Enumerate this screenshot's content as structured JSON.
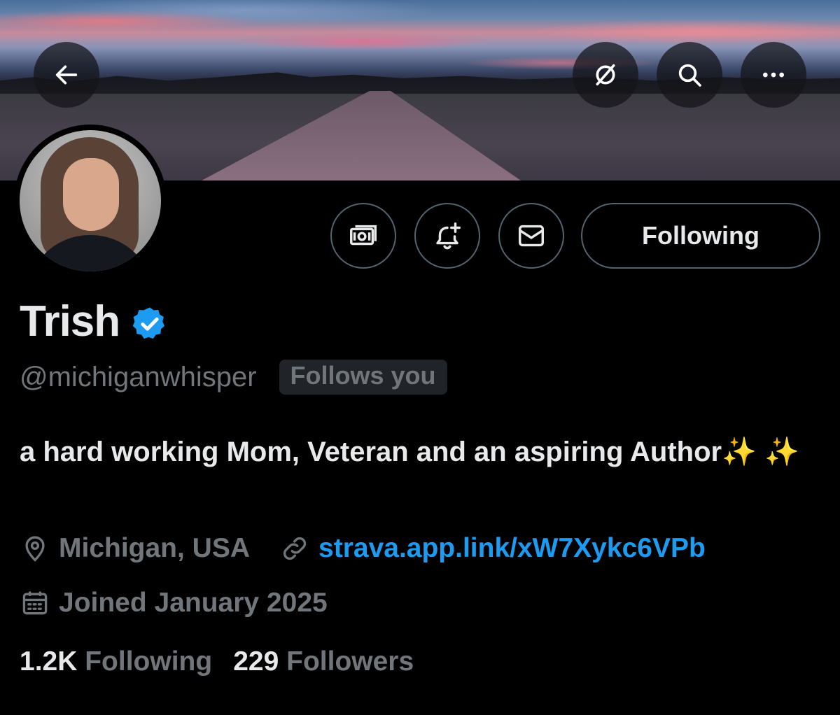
{
  "header": {
    "back_icon": "back-arrow-icon",
    "grok_icon": "grok-icon",
    "search_icon": "search-icon",
    "more_icon": "more-icon"
  },
  "actions": {
    "tip_icon": "money-icon",
    "notify_icon": "bell-plus-icon",
    "message_icon": "envelope-icon",
    "following_label": "Following"
  },
  "profile": {
    "name": "Trish",
    "handle": "@michiganwhisper",
    "follows_you": "Follows you",
    "bio": "a hard working Mom, Veteran and an aspiring Author✨ ✨",
    "location": "Michigan, USA",
    "website": "strava.app.link/xW7Xykc6VPb",
    "joined": "Joined January 2025"
  },
  "stats": {
    "following_count": "1.2K",
    "following_label": "Following",
    "followers_count": "229",
    "followers_label": "Followers"
  },
  "colors": {
    "accent": "#1d9bf0",
    "muted": "#71767b",
    "text": "#e7e9ea",
    "border": "#536471"
  }
}
